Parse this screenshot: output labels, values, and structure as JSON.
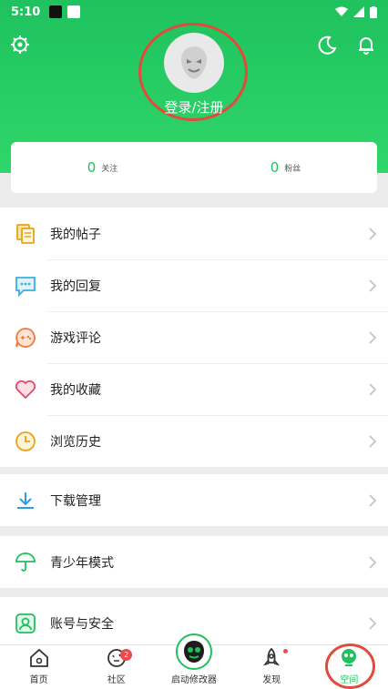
{
  "status_bar": {
    "time": "5:10"
  },
  "header": {
    "login_label": "登录/注册",
    "icons": [
      "settings-icon",
      "night-mode-icon",
      "notification-bell-icon"
    ]
  },
  "stats": [
    {
      "value": "0",
      "label": "关注"
    },
    {
      "value": "0",
      "label": "粉丝"
    }
  ],
  "menu": {
    "posts": "我的帖子",
    "replies": "我的回复",
    "game_reviews": "游戏评论",
    "favorites": "我的收藏",
    "history": "浏览历史",
    "downloads": "下载管理",
    "teen_mode": "青少年模式",
    "account": "账号与安全"
  },
  "bottom_nav": {
    "home": "首页",
    "community": "社区",
    "community_badge": "2",
    "launcher": "启动修改器",
    "discover": "发现",
    "space": "空间"
  },
  "colors": {
    "accent": "#20c05c",
    "highlight": "#e24a3b"
  }
}
